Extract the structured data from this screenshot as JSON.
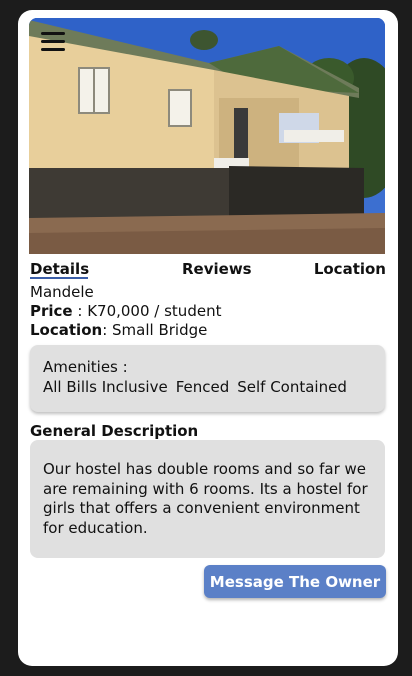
{
  "tabs": {
    "details": "Details",
    "reviews": "Reviews",
    "location": "Location"
  },
  "property": {
    "name": "Mandele",
    "price_label": "Price",
    "price_value": " : K70,000 / student",
    "location_label": "Location",
    "location_value": ": Small Bridge"
  },
  "amenities": {
    "title": "Amenities :",
    "items": [
      "All Bills Inclusive",
      "Fenced",
      "Self Contained"
    ]
  },
  "description": {
    "title": "General Description",
    "text": "Our hostel has double rooms and so far we are remaining with 6 rooms. Its a hostel for girls that offers a convenient environment for education."
  },
  "actions": {
    "message_owner": "Message The Owner"
  },
  "icons": {
    "menu": "hamburger-menu-icon"
  },
  "colors": {
    "accent": "#5b80c7",
    "tab_underline": "#3b5ea8",
    "panel": "#e0e0e0",
    "background": "#1c1c1c"
  }
}
